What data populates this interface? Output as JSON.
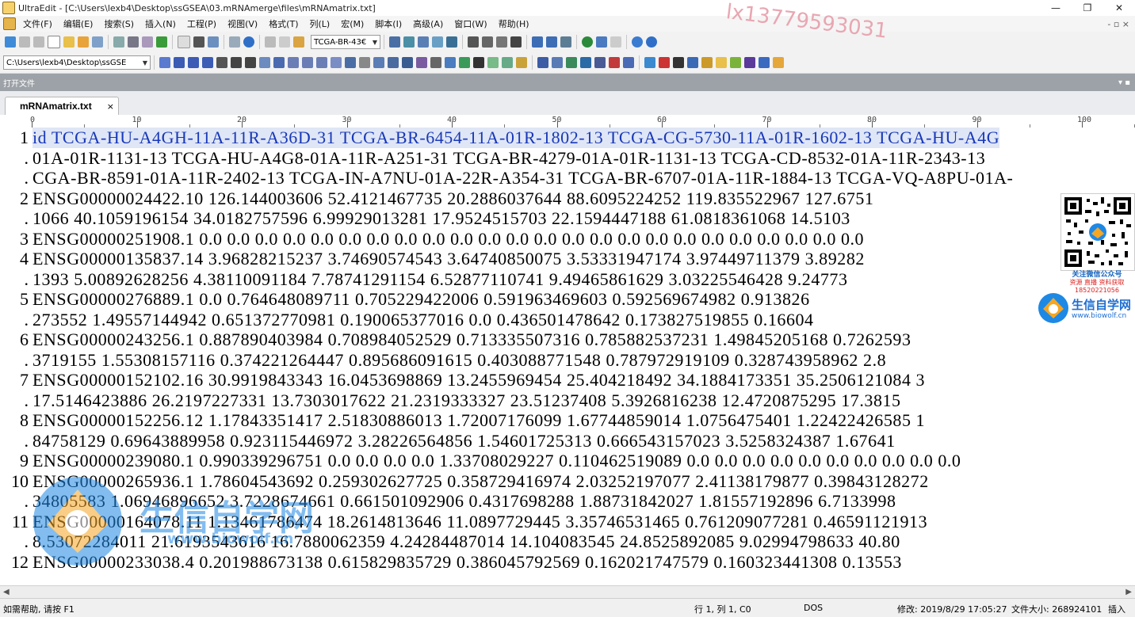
{
  "window": {
    "title": "UltraEdit - [C:\\Users\\lexb4\\Desktop\\ssGSEA\\03.mRNAmerge\\files\\mRNAmatrix.txt]",
    "controls": [
      "—",
      "❐",
      "✕"
    ]
  },
  "menu": {
    "items": [
      "文件(F)",
      "编辑(E)",
      "搜索(S)",
      "插入(N)",
      "工程(P)",
      "视图(V)",
      "格式(T)",
      "列(L)",
      "宏(M)",
      "脚本(I)",
      "高级(A)",
      "窗口(W)",
      "帮助(H)"
    ],
    "right_glyph": "- ▫ ×"
  },
  "toolbar1": {
    "combo_value": "TCGA-BR-43€"
  },
  "toolbar2": {
    "path_combo_value": "C:\\Users\\lexb4\\Desktop\\ssGSE"
  },
  "file_panel": {
    "label": "打开文件",
    "buttons": "▾ ▪"
  },
  "tab": {
    "label": "mRNAmatrix.txt",
    "close": "×"
  },
  "ruler": {
    "marks": [
      "0",
      "10",
      "20",
      "30",
      "40",
      "50",
      "60",
      "70",
      "80",
      "90",
      "100"
    ]
  },
  "editor": {
    "lines": [
      {
        "num": "1",
        "text": "id  TCGA-HU-A4GH-11A-11R-A36D-31   TCGA-BR-6454-11A-01R-1802-13   TCGA-CG-5730-11A-01R-1602-13   TCGA-HU-A4G",
        "highlight": true
      },
      {
        "num": ".",
        "text": "01A-01R-1131-13  TCGA-HU-A4G8-01A-11R-A251-31   TCGA-BR-4279-01A-01R-1131-13   TCGA-CD-8532-01A-11R-2343-13",
        "highlight": false
      },
      {
        "num": ".",
        "text": "CGA-BR-8591-01A-11R-2402-13  TCGA-IN-A7NU-01A-22R-A354-31   TCGA-BR-6707-01A-11R-1884-13   TCGA-VQ-A8PU-01A-",
        "highlight": false
      },
      {
        "num": "2",
        "text": "ENSG00000024422.10   126.144003606  52.4121467735  20.2886037644  88.6095224252  119.835522967  127.6751",
        "highlight": false
      },
      {
        "num": ".",
        "text": "1066   40.1059196154  34.0182757596  6.99929013281  17.9524515703  22.1594447188  61.0818361068  14.5103",
        "highlight": false
      },
      {
        "num": "3",
        "text": "ENSG00000251908.1  0.0  0.0  0.0  0.0  0.0  0.0  0.0  0.0  0.0  0.0  0.0  0.0  0.0  0.0  0.0  0.0  0.0  0.0  0.0  0.0  0.0  0.0  0.0  0.0",
        "highlight": false
      },
      {
        "num": "4",
        "text": "ENSG00000135837.14   3.96828215237  3.74690574543  3.64740850075  3.53331947174  3.97449711379  3.89282",
        "highlight": false
      },
      {
        "num": ".",
        "text": "1393   5.00892628256  4.38110091184  7.78741291154  6.52877110741  9.49465861629  3.03225546428  9.24773",
        "highlight": false
      },
      {
        "num": "5",
        "text": "ENSG00000276889.1  0.0  0.764648089711   0.705229422006   0.591963469603   0.592569674982   0.913826",
        "highlight": false
      },
      {
        "num": ".",
        "text": "273552   1.49557144942  0.651372770981   0.190065377016   0.0  0.436501478642   0.173827519855   0.16604",
        "highlight": false
      },
      {
        "num": "6",
        "text": "ENSG00000243256.1  0.887890403984   0.708984052529   0.713335507316   0.785882537231   1.49845205168  0.7262593",
        "highlight": false
      },
      {
        "num": ".",
        "text": "3719155  1.55308157116  0.374221264447   0.895686091615   0.403088771548   0.787972919109   0.328743958962   2.8",
        "highlight": false
      },
      {
        "num": "7",
        "text": "ENSG00000152102.16   30.9919843343  16.0453698869  13.2455969454  25.404218492   34.1884173351  35.2506121084  3",
        "highlight": false
      },
      {
        "num": ".",
        "text": "  17.5146423886  26.2197227331  13.7303017622  21.2319333327  23.51237408  5.3926816238   12.4720875295  17.3815",
        "highlight": false
      },
      {
        "num": "8",
        "text": "ENSG00000152256.12   1.17843351417  2.51830886013  1.72007176099  1.67744859014  1.0756475401   1.22422426585  1",
        "highlight": false
      },
      {
        "num": ".",
        "text": "84758129   0.69643889958  0.923115446972   3.28226564856  1.54601725313  0.666543157023   3.5258324387   1.67641",
        "highlight": false
      },
      {
        "num": "9",
        "text": "ENSG00000239080.1  0.990339296751   0.0  0.0  0.0  0.0  1.33708029227  0.110462519089   0.0  0.0  0.0  0.0  0.0  0.0  0.0  0.0  0.0  0.0",
        "highlight": false
      },
      {
        "num": "10",
        "text": "ENSG00000265936.1  1.78604543692  0.259302627725   0.358729416974   2.03252197077  2.41138179877  0.39843128272",
        "highlight": false
      },
      {
        "num": ".",
        "text": "34805583   1.06946896652  3.7228674661   0.661501092906   0.4317698288   1.88731842027  1.81557192896  6.7133998",
        "highlight": false
      },
      {
        "num": "11",
        "text": "ENSG00000164078.11   1.13461786474  18.2614813646  11.0897729445  3.35746531465  0.761209077281   0.46591121913",
        "highlight": false
      },
      {
        "num": ".",
        "text": "  8.53072284011  21.6193543616  16.7880062359  4.24284487014  14.104083545   24.8525892085  9.02994798633  40.80",
        "highlight": false
      },
      {
        "num": "12",
        "text": "ENSG00000233038.4  0.201988673138   0.615829835729   0.386045792569   0.162021747579   0.160323441308   0.13553",
        "highlight": false
      }
    ]
  },
  "status": {
    "help": "如需帮助, 请按 F1",
    "position": "行 1, 列 1, C0",
    "format": "DOS",
    "modified": "修改: 2019/8/29 17:05:27",
    "size": "文件大小: 268924101",
    "mode": "插入"
  },
  "overlays": {
    "watermark_text": "lx13779593031",
    "qr_caption_1": "关注微信公众号",
    "qr_caption_2": "资源 直播 资料获取",
    "qr_caption_3": "18520221056",
    "logo_text": "生信自学网",
    "logo_url": "www.biowolf.cn",
    "big_logo_text": "生信自学网",
    "big_logo_url": "www.biowolf.cn"
  }
}
